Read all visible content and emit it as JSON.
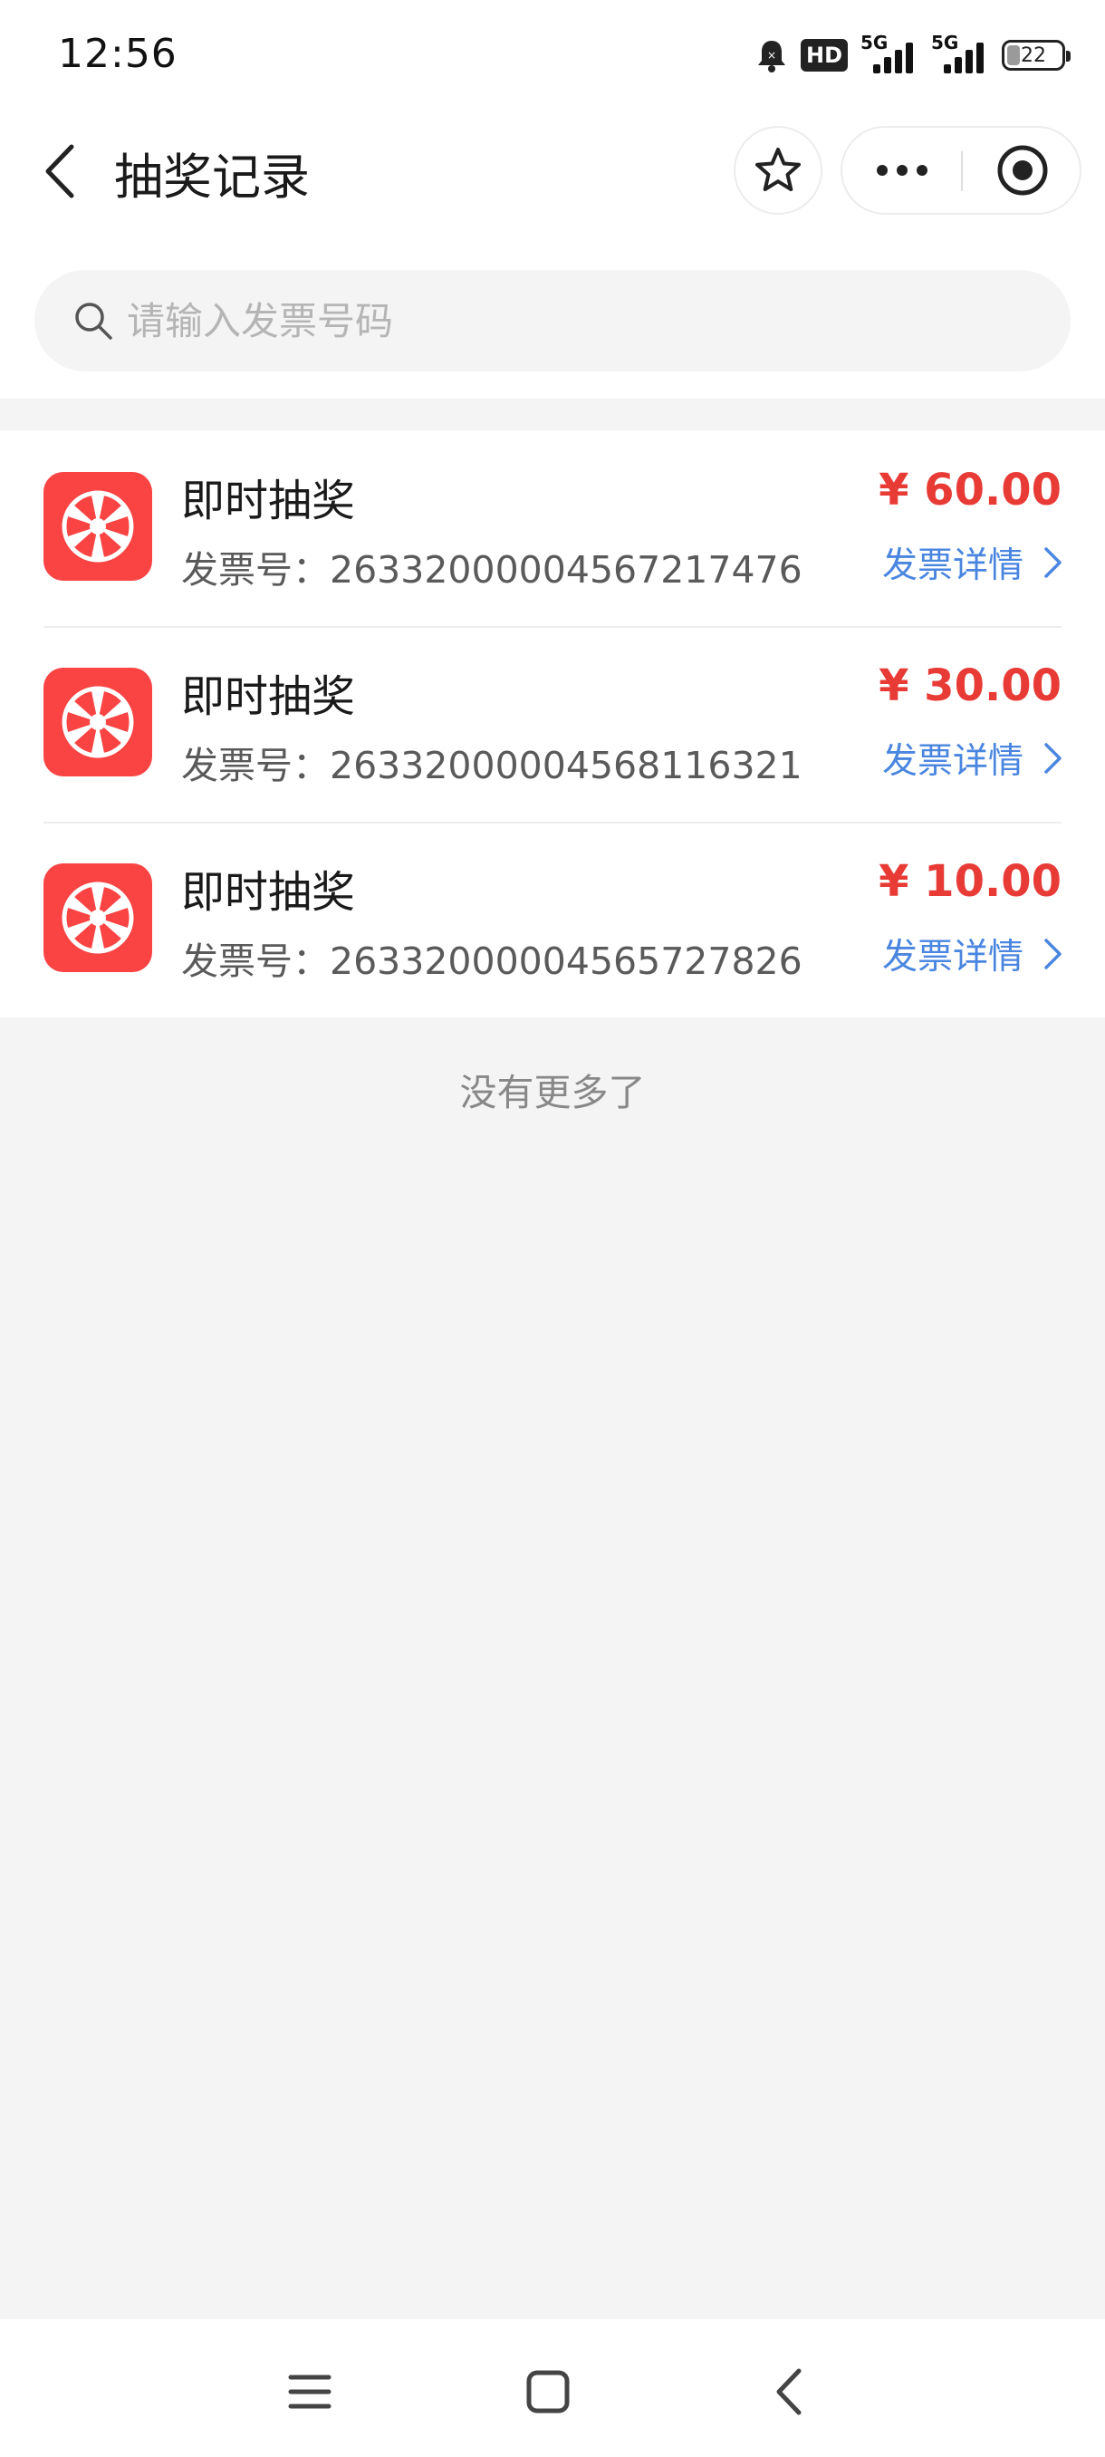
{
  "status_bar": {
    "time": "12:56",
    "hd": "HD",
    "net1": "5G",
    "net2": "5G",
    "battery": "22"
  },
  "nav": {
    "title": "抽奖记录"
  },
  "search": {
    "placeholder": "请输入发票号码"
  },
  "records": [
    {
      "title": "即时抽奖",
      "invoice_label": "发票号：",
      "invoice_no": "26332000004567217476",
      "amount": "¥ 60.00",
      "detail": "发票详情"
    },
    {
      "title": "即时抽奖",
      "invoice_label": "发票号：",
      "invoice_no": "26332000004568116321",
      "amount": "¥ 30.00",
      "detail": "发票详情"
    },
    {
      "title": "即时抽奖",
      "invoice_label": "发票号：",
      "invoice_no": "26332000004565727826",
      "amount": "¥ 10.00",
      "detail": "发票详情"
    }
  ],
  "footer_text": "没有更多了",
  "colors": {
    "accent_red": "#e83b36",
    "icon_red": "#fa4343",
    "link_blue": "#4a86e0",
    "page_bg": "#f4f4f4"
  },
  "icons": {
    "back": "chevron-left-icon",
    "favorite": "star-icon",
    "more": "more-dots-icon",
    "mini_program_close": "target-icon",
    "search": "search-icon",
    "record": "lottery-wheel-icon",
    "detail": "chevron-right-icon"
  }
}
